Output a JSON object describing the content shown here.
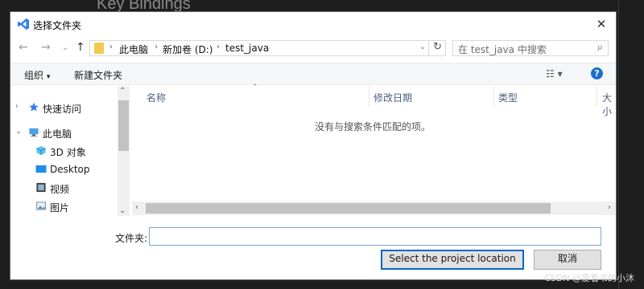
{
  "background": {
    "title": "Key Bindings",
    "watermark": "CSDN @爱看书的小沐"
  },
  "dialog": {
    "title": "选择文件夹",
    "close_glyph": "✕",
    "nav": {
      "back": "←",
      "forward": "→",
      "recent": "⌄",
      "up": "↑"
    },
    "address": {
      "crumbs": [
        "此电脑",
        "新加卷 (D:)",
        "test_java"
      ],
      "sep_glyph": "›",
      "dropdown_glyph": "⌄",
      "refresh_glyph": "↻"
    },
    "search": {
      "placeholder": "在 test_java 中搜索",
      "icon_glyph": "⌕"
    },
    "toolbar": {
      "organize": "组织",
      "organize_caret": "▾",
      "new_folder": "新建文件夹",
      "view_glyph": "☷ ▾",
      "help_glyph": "?"
    },
    "tree": [
      {
        "label": "快速访问",
        "icon": "star-icon",
        "chevron": "›"
      },
      {
        "label": "此电脑",
        "icon": "computer-icon",
        "chevron": "⌄"
      },
      {
        "label": "3D 对象",
        "icon": "cube-icon"
      },
      {
        "label": "Desktop",
        "icon": "desktop-icon"
      },
      {
        "label": "视频",
        "icon": "video-icon"
      },
      {
        "label": "图片",
        "icon": "picture-icon"
      }
    ],
    "columns": [
      "名称",
      "修改日期",
      "类型",
      "大小"
    ],
    "sort_glyph": "⌃",
    "empty_message": "没有与搜索条件匹配的项。",
    "scroll": {
      "up": "⌃",
      "down": "⌄",
      "left": "‹",
      "right": "›"
    },
    "filename_label": "文件夹:",
    "filename_value": "",
    "select_button": "Select the project location",
    "cancel_button": "取消",
    "colors": {
      "accent": "#0a64c8",
      "help": "#1c6fc9",
      "vscode_blue": "#2f80ed"
    }
  }
}
